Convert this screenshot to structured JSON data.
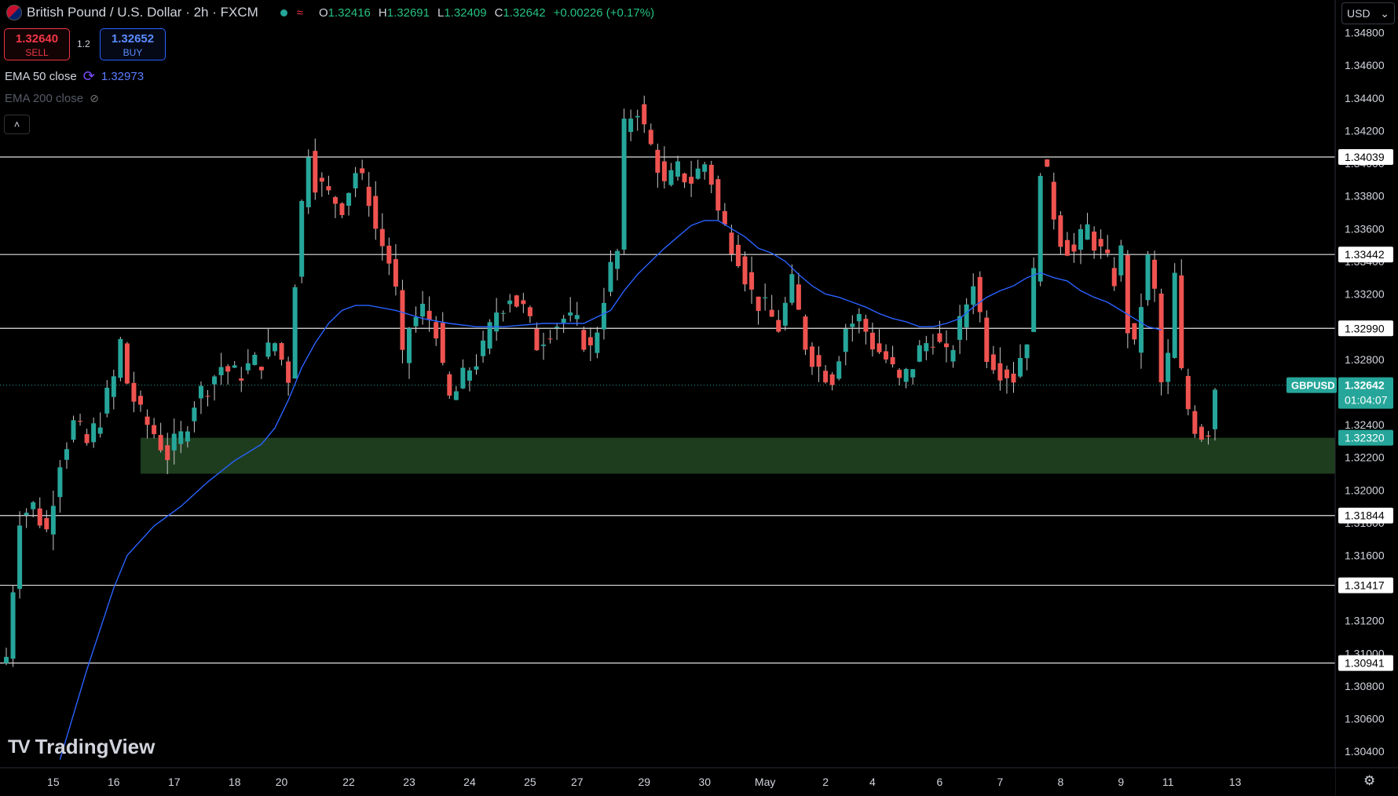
{
  "header": {
    "title": "British Pound / U.S. Dollar · 2h · FXCM",
    "ohlc": [
      {
        "k": "O",
        "v": "1.32416"
      },
      {
        "k": "H",
        "v": "1.32691"
      },
      {
        "k": "L",
        "v": "1.32409"
      },
      {
        "k": "C",
        "v": "1.32642"
      }
    ],
    "change": "+0.00226 (+0.17%)"
  },
  "trade": {
    "sell_price": "1.32640",
    "sell_label": "SELL",
    "buy_price": "1.32652",
    "buy_label": "BUY",
    "spread": "1.2"
  },
  "indicators": {
    "ema50_label": "EMA 50 close",
    "ema50_value": "1.32973",
    "ema200_label": "EMA 200 close"
  },
  "currency": "USD",
  "logo_text": "TradingView",
  "colors": {
    "up": "#26a69a",
    "down": "#ef5350",
    "ema50": "#2962ff",
    "zone": "#1e3d1f",
    "price_label": "#26a69a"
  },
  "chart_data": {
    "type": "candlestick",
    "symbol": "GBPUSD",
    "timeframe": "2h",
    "ylim": [
      1.303,
      1.35
    ],
    "y_ticks": [
      "1.34800",
      "1.34600",
      "1.34400",
      "1.34200",
      "1.34000",
      "1.33800",
      "1.33600",
      "1.33400",
      "1.33200",
      "1.33000",
      "1.32800",
      "1.32600",
      "1.32400",
      "1.32200",
      "1.32000",
      "1.31800",
      "1.31600",
      "1.31400",
      "1.31200",
      "1.31000",
      "1.30800",
      "1.30600",
      "1.30400"
    ],
    "x_labels": [
      "15",
      "16",
      "17",
      "18",
      "20",
      "22",
      "23",
      "24",
      "25",
      "27",
      "29",
      "30",
      "May",
      "2",
      "4",
      "6",
      "7",
      "8",
      "9",
      "11",
      "13"
    ],
    "x_label_slots": [
      7,
      16,
      25,
      34,
      41,
      51,
      60,
      69,
      78,
      85,
      95,
      104,
      113,
      122,
      129,
      139,
      148,
      157,
      166,
      173,
      183
    ],
    "horizontal_lines": [
      {
        "value": 1.34039,
        "label": "1.34039"
      },
      {
        "value": 1.33442,
        "label": "1.33442"
      },
      {
        "value": 1.3299,
        "label": "1.32990"
      },
      {
        "value": 1.31844,
        "label": "1.31844"
      },
      {
        "value": 1.31417,
        "label": "1.31417"
      },
      {
        "value": 1.30941,
        "label": "1.30941"
      }
    ],
    "zone": {
      "top": 1.3232,
      "bottom": 1.321,
      "label": "1.32320",
      "start_slot": 20
    },
    "last_price": {
      "value": 1.32642,
      "label": "1.32642",
      "symbol_label": "GBPUSD",
      "countdown": "01:04:07"
    },
    "ohlc_keypoints": [
      [
        0,
        1.3098
      ],
      [
        2,
        1.3185
      ],
      [
        4,
        1.319
      ],
      [
        6,
        1.3175
      ],
      [
        8,
        1.322
      ],
      [
        10,
        1.324
      ],
      [
        12,
        1.3228
      ],
      [
        14,
        1.3245
      ],
      [
        16,
        1.3268
      ],
      [
        17,
        1.329
      ],
      [
        18,
        1.3266
      ],
      [
        20,
        1.3245
      ],
      [
        22,
        1.3235
      ],
      [
        24,
        1.3222
      ],
      [
        26,
        1.3232
      ],
      [
        28,
        1.3255
      ],
      [
        30,
        1.3265
      ],
      [
        32,
        1.3276
      ],
      [
        34,
        1.327
      ],
      [
        36,
        1.3275
      ],
      [
        38,
        1.328
      ],
      [
        40,
        1.329
      ],
      [
        42,
        1.327
      ],
      [
        43,
        1.333
      ],
      [
        44,
        1.3375
      ],
      [
        45,
        1.341
      ],
      [
        46,
        1.339
      ],
      [
        48,
        1.338
      ],
      [
        50,
        1.3375
      ],
      [
        52,
        1.3395
      ],
      [
        54,
        1.338
      ],
      [
        55,
        1.336
      ],
      [
        57,
        1.334
      ],
      [
        58,
        1.332
      ],
      [
        59,
        1.3278
      ],
      [
        60,
        1.33
      ],
      [
        62,
        1.331
      ],
      [
        64,
        1.33
      ],
      [
        65,
        1.327
      ],
      [
        66,
        1.3255
      ],
      [
        67,
        1.326
      ],
      [
        69,
        1.3275
      ],
      [
        71,
        1.3285
      ],
      [
        73,
        1.331
      ],
      [
        75,
        1.332
      ],
      [
        77,
        1.331
      ],
      [
        79,
        1.329
      ],
      [
        81,
        1.33
      ],
      [
        83,
        1.3305
      ],
      [
        85,
        1.33
      ],
      [
        87,
        1.3285
      ],
      [
        88,
        1.33
      ],
      [
        89,
        1.332
      ],
      [
        90,
        1.3335
      ],
      [
        91,
        1.3345
      ],
      [
        92,
        1.342
      ],
      [
        93,
        1.343
      ],
      [
        94,
        1.3435
      ],
      [
        95,
        1.342
      ],
      [
        97,
        1.34
      ],
      [
        98,
        1.3385
      ],
      [
        100,
        1.3395
      ],
      [
        102,
        1.339
      ],
      [
        104,
        1.34
      ],
      [
        105,
        1.339
      ],
      [
        106,
        1.337
      ],
      [
        107,
        1.336
      ],
      [
        109,
        1.3345
      ],
      [
        111,
        1.332
      ],
      [
        113,
        1.331
      ],
      [
        115,
        1.33
      ],
      [
        117,
        1.3325
      ],
      [
        119,
        1.329
      ],
      [
        121,
        1.3275
      ],
      [
        123,
        1.327
      ],
      [
        125,
        1.33
      ],
      [
        127,
        1.3305
      ],
      [
        129,
        1.329
      ],
      [
        131,
        1.328
      ],
      [
        133,
        1.3265
      ],
      [
        134,
        1.327
      ],
      [
        136,
        1.3285
      ],
      [
        138,
        1.3295
      ],
      [
        140,
        1.328
      ],
      [
        142,
        1.33
      ],
      [
        144,
        1.333
      ],
      [
        146,
        1.3285
      ],
      [
        148,
        1.3275
      ],
      [
        150,
        1.327
      ],
      [
        152,
        1.3295
      ],
      [
        153,
        1.333
      ],
      [
        154,
        1.34
      ],
      [
        155,
        1.339
      ],
      [
        156,
        1.337
      ],
      [
        157,
        1.3355
      ],
      [
        159,
        1.3345
      ],
      [
        161,
        1.336
      ],
      [
        163,
        1.3345
      ],
      [
        165,
        1.333
      ],
      [
        166,
        1.3345
      ],
      [
        167,
        1.33
      ],
      [
        168,
        1.3285
      ],
      [
        169,
        1.3315
      ],
      [
        170,
        1.334
      ],
      [
        171,
        1.332
      ],
      [
        172,
        1.3265
      ],
      [
        173,
        1.328
      ],
      [
        174,
        1.333
      ],
      [
        175,
        1.327
      ],
      [
        176,
        1.325
      ],
      [
        177,
        1.324
      ],
      [
        178,
        1.3235
      ],
      [
        179,
        1.3238
      ],
      [
        180,
        1.3264
      ]
    ],
    "ema50_keypoints": [
      [
        8,
        1.3035
      ],
      [
        12,
        1.309
      ],
      [
        16,
        1.314
      ],
      [
        18,
        1.316
      ],
      [
        22,
        1.3178
      ],
      [
        26,
        1.319
      ],
      [
        30,
        1.3205
      ],
      [
        34,
        1.3218
      ],
      [
        38,
        1.3228
      ],
      [
        40,
        1.3238
      ],
      [
        42,
        1.3255
      ],
      [
        44,
        1.3275
      ],
      [
        46,
        1.329
      ],
      [
        48,
        1.3302
      ],
      [
        50,
        1.331
      ],
      [
        52,
        1.3313
      ],
      [
        54,
        1.3313
      ],
      [
        58,
        1.331
      ],
      [
        62,
        1.3305
      ],
      [
        66,
        1.3302
      ],
      [
        70,
        1.33
      ],
      [
        74,
        1.33
      ],
      [
        80,
        1.3302
      ],
      [
        86,
        1.3302
      ],
      [
        90,
        1.331
      ],
      [
        92,
        1.3322
      ],
      [
        94,
        1.3332
      ],
      [
        96,
        1.334
      ],
      [
        98,
        1.3348
      ],
      [
        100,
        1.3355
      ],
      [
        102,
        1.3362
      ],
      [
        104,
        1.3365
      ],
      [
        106,
        1.3365
      ],
      [
        108,
        1.336
      ],
      [
        110,
        1.3355
      ],
      [
        112,
        1.3348
      ],
      [
        114,
        1.3345
      ],
      [
        116,
        1.334
      ],
      [
        118,
        1.3332
      ],
      [
        120,
        1.3325
      ],
      [
        122,
        1.332
      ],
      [
        124,
        1.3318
      ],
      [
        126,
        1.3315
      ],
      [
        128,
        1.3312
      ],
      [
        130,
        1.3308
      ],
      [
        132,
        1.3305
      ],
      [
        134,
        1.3303
      ],
      [
        136,
        1.33
      ],
      [
        138,
        1.33
      ],
      [
        140,
        1.3302
      ],
      [
        142,
        1.3305
      ],
      [
        144,
        1.3312
      ],
      [
        146,
        1.3318
      ],
      [
        148,
        1.3322
      ],
      [
        150,
        1.3325
      ],
      [
        152,
        1.333
      ],
      [
        154,
        1.3333
      ],
      [
        156,
        1.333
      ],
      [
        158,
        1.3328
      ],
      [
        160,
        1.3322
      ],
      [
        162,
        1.3318
      ],
      [
        164,
        1.3315
      ],
      [
        166,
        1.331
      ],
      [
        168,
        1.3305
      ],
      [
        170,
        1.33
      ],
      [
        172,
        1.3298
      ]
    ],
    "bars": 181,
    "grid": false,
    "legend": "top-left"
  }
}
